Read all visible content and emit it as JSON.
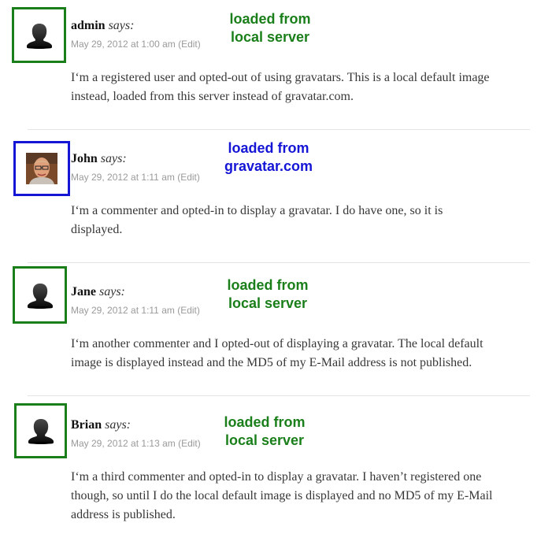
{
  "comments": [
    {
      "author": "admin",
      "says": "says:",
      "date": "May 29, 2012 at 1:00 am",
      "edit": "(Edit)",
      "avatar": "default-silhouette-icon",
      "note_lines": [
        "loaded from",
        "local server"
      ],
      "note_color": "#1a7f1a",
      "body_lines": [
        "I‘m a registered user and opted-out of using gravatars. This is a local default image",
        "instead, loaded from this server instead of gravatar.com."
      ]
    },
    {
      "author": "John",
      "says": "says:",
      "date": "May 29, 2012 at 1:11 am",
      "edit": "(Edit)",
      "avatar": "gravatar-photo",
      "note_lines": [
        "loaded from",
        "gravatar.com"
      ],
      "note_color": "#1515d6",
      "body_lines": [
        "I‘m a commenter and opted-in to display a gravatar. I do have one, so it is",
        "displayed."
      ]
    },
    {
      "author": "Jane",
      "says": "says:",
      "date": "May 29, 2012 at 1:11 am",
      "edit": "(Edit)",
      "avatar": "default-silhouette-icon",
      "note_lines": [
        "loaded from",
        "local server"
      ],
      "note_color": "#1a7f1a",
      "body_lines": [
        "I‘m another commenter and I opted-out of displaying a gravatar. The local default",
        "image is displayed instead and the MD5 of my E-Mail address is not published."
      ]
    },
    {
      "author": "Brian",
      "says": "says:",
      "date": "May 29, 2012 at 1:13 am",
      "edit": "(Edit)",
      "avatar": "default-silhouette-icon",
      "note_lines": [
        "loaded from",
        "local server"
      ],
      "note_color": "#1a7f1a",
      "body_lines": [
        "I‘m a third commenter and opted-in to display a gravatar. I haven’t registered one",
        "though, so until I do the local default image is displayed and no MD5 of my E-Mail",
        "address is published."
      ]
    }
  ]
}
